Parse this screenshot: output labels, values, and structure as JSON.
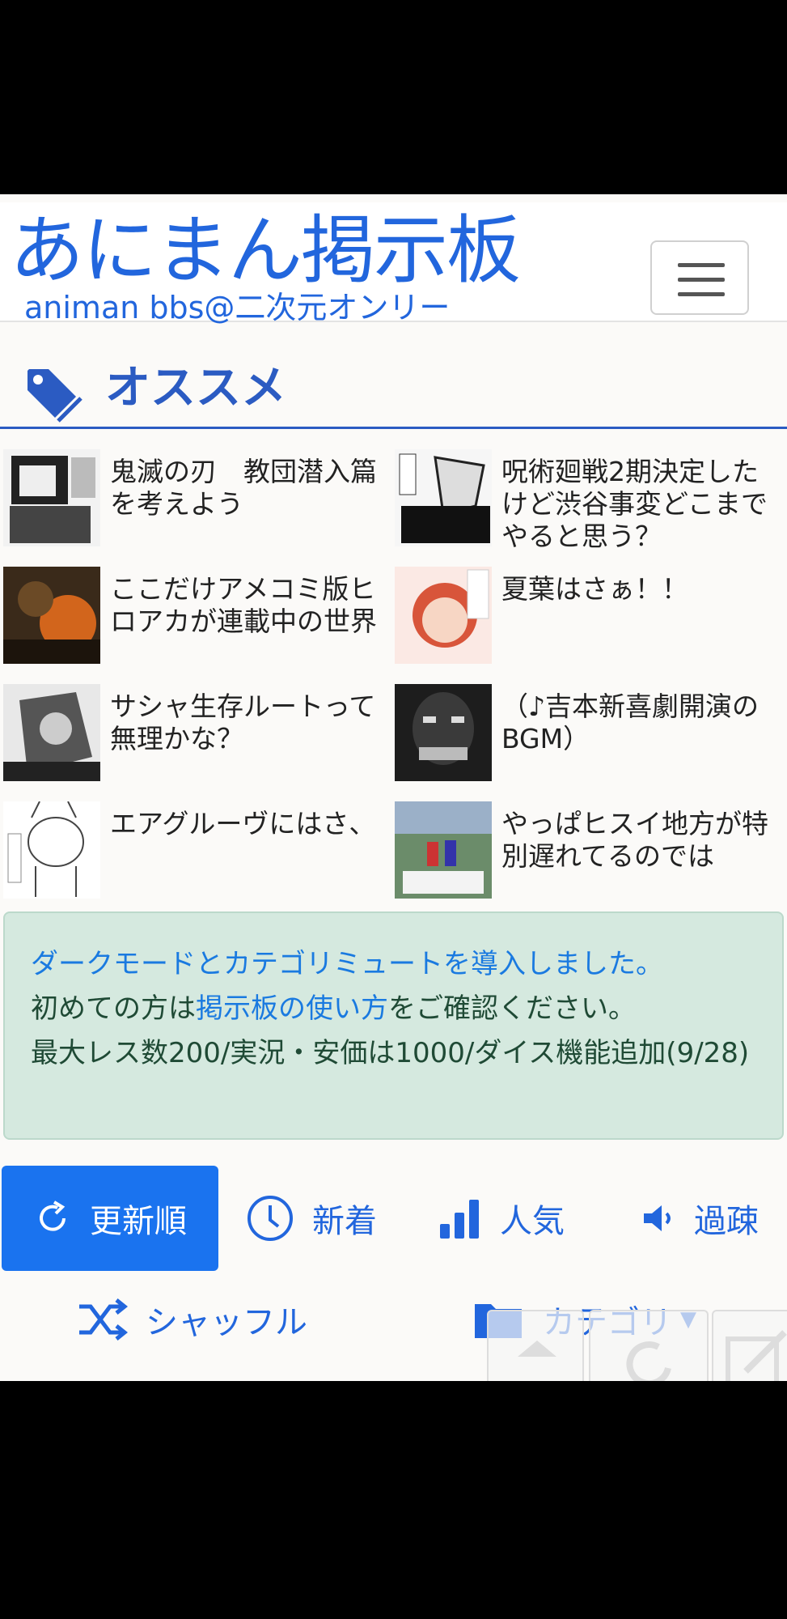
{
  "header": {
    "logo_main": "あにまん掲示板",
    "logo_sub": "animan bbs@二次元オンリー"
  },
  "recommend": {
    "title": "オススメ",
    "items": [
      {
        "title": "鬼滅の刃　教団潜入篇を考えよう"
      },
      {
        "title": "呪術廻戦2期決定したけど渋谷事変どこまでやると思う？"
      },
      {
        "title": "ここだけアメコミ版ヒロアカが連載中の世界"
      },
      {
        "title": "夏葉はさぁ！！"
      },
      {
        "title": "サシャ生存ルートって無理かな？"
      },
      {
        "title": "（♪吉本新喜劇開演のBGM）"
      },
      {
        "title": "エアグルーヴにはさ、"
      },
      {
        "title": "やっぱヒスイ地方が特別遅れてるのでは"
      }
    ]
  },
  "notice": {
    "line1_link": "ダークモードとカテゴリミュートを導入しました。",
    "line2_pre": "初めての方は",
    "line2_link": "掲示板の使い方",
    "line2_post": "をご確認ください。",
    "line3": "最大レス数200/実況・安価は1000/ダイス機能追加(9/28)"
  },
  "tabs": [
    {
      "label": "更新順",
      "icon": "refresh-icon",
      "active": true
    },
    {
      "label": "新着",
      "icon": "clock-icon",
      "active": false
    },
    {
      "label": "人気",
      "icon": "bar-chart-icon",
      "active": false
    },
    {
      "label": "過疎",
      "icon": "speaker-icon",
      "active": false
    }
  ],
  "row2": {
    "shuffle_label": "シャッフル",
    "category_label": "カテゴリ"
  },
  "colors": {
    "accent": "#2266dd",
    "active_tab": "#1a73ef",
    "notice_bg": "#d5e9df"
  }
}
